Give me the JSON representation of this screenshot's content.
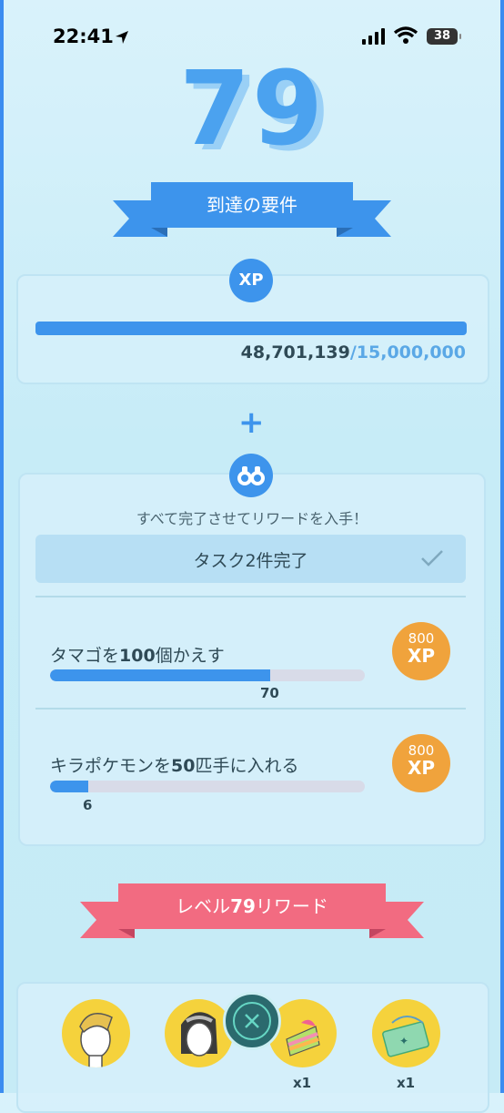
{
  "status_bar": {
    "time": "22:41",
    "battery": "38"
  },
  "level": {
    "number": "79"
  },
  "requirements_banner": {
    "label": "到達の要件"
  },
  "xp_card": {
    "badge": "XP",
    "current": "48,701,139",
    "target": "/15,000,000"
  },
  "plus_sign": "+",
  "tasks_card": {
    "hint": "すべて完了させてリワードを入手！",
    "summary": "タスク2件完了",
    "tasks": [
      {
        "title_pre": "タマゴを",
        "title_num": "100",
        "title_post": "個かえす",
        "value": "70",
        "goal": 100,
        "reward_amount": "800",
        "reward_unit": "XP"
      },
      {
        "title_pre": "キラポケモンを",
        "title_num": "50",
        "title_post": "匹手に入れる",
        "value": "6",
        "goal": 50,
        "reward_amount": "800",
        "reward_unit": "XP"
      }
    ]
  },
  "rewards_banner": {
    "label_pre": "レベル",
    "label_num": "79",
    "label_post": "リワード"
  },
  "rewards": [
    {
      "icon": "avatar-hair-icon",
      "qty": ""
    },
    {
      "icon": "avatar-hair-long-icon",
      "qty": ""
    },
    {
      "icon": "rainbow-cake-icon",
      "qty": "x1"
    },
    {
      "icon": "ticket-icon",
      "qty": "x1"
    }
  ],
  "colors": {
    "accent": "#3d94ec",
    "pink": "#f26b81",
    "coin": "#f0a33c",
    "gold": "#f5d23c"
  }
}
